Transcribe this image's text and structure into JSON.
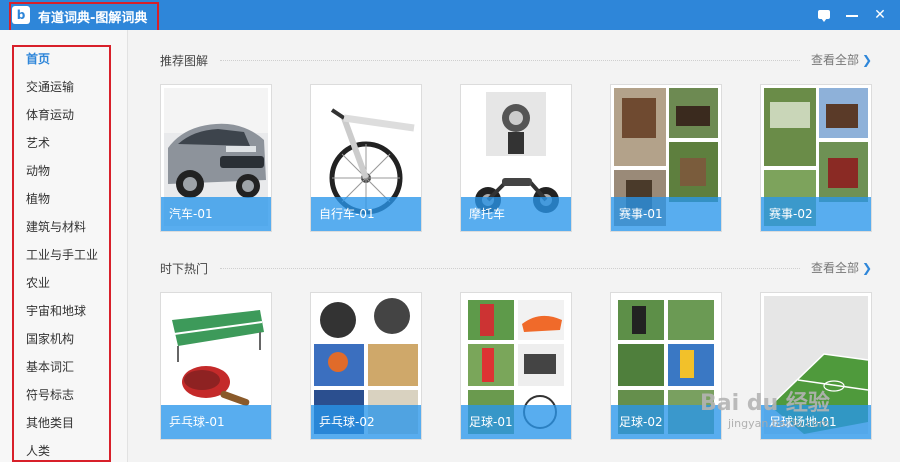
{
  "window": {
    "logo": "b",
    "title": "有道词典-图解词典"
  },
  "sidebar": {
    "items": [
      {
        "label": "首页",
        "active": true
      },
      {
        "label": "交通运输"
      },
      {
        "label": "体育运动"
      },
      {
        "label": "艺术"
      },
      {
        "label": "动物"
      },
      {
        "label": "植物"
      },
      {
        "label": "建筑与材料"
      },
      {
        "label": "工业与手工业"
      },
      {
        "label": "农业"
      },
      {
        "label": "宇宙和地球"
      },
      {
        "label": "国家机构"
      },
      {
        "label": "基本词汇"
      },
      {
        "label": "符号标志"
      },
      {
        "label": "其他类目"
      },
      {
        "label": "人类"
      }
    ]
  },
  "sections": [
    {
      "title": "推荐图解",
      "view_all": "查看全部",
      "cards": [
        {
          "label": "汽车-01"
        },
        {
          "label": "自行车-01"
        },
        {
          "label": "摩托车"
        },
        {
          "label": "赛事-01"
        },
        {
          "label": "赛事-02"
        }
      ]
    },
    {
      "title": "时下热门",
      "view_all": "查看全部",
      "cards": [
        {
          "label": "乒乓球-01"
        },
        {
          "label": "乒乓球-02"
        },
        {
          "label": "足球-01"
        },
        {
          "label": "足球-02"
        },
        {
          "label": "足球场地-01"
        }
      ]
    }
  ],
  "watermark": {
    "text": "Bai du 经验",
    "sub": "jingyan.baidu.com"
  },
  "colors": {
    "accent": "#2e86d9",
    "caption_bg": "#2996eb",
    "highlight_box": "#d8202a"
  }
}
